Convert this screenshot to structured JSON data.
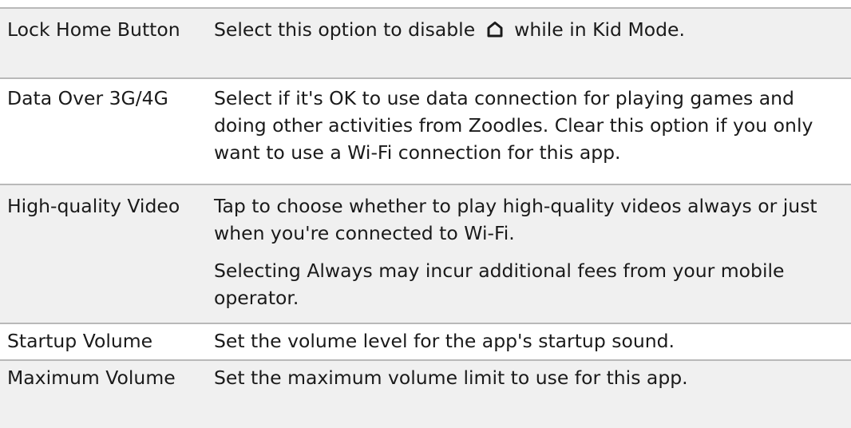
{
  "rows": [
    {
      "name": "Lock Home Button",
      "desc_before_icon": "Select this option to disable",
      "icon": "home-icon",
      "desc_after_icon": "while in Kid Mode."
    },
    {
      "name": "Data Over 3G/4G",
      "desc": "Select if it's OK to use data connection for playing games and doing other activities from Zoodles. Clear this option if you only want to use a Wi-Fi connection for this app."
    },
    {
      "name": "High-quality Video",
      "desc": "Tap to choose whether to play high-quality videos always or just when you're connected to Wi-Fi.",
      "desc2_before": "Selecting",
      "desc2_emphasis": "Always",
      "desc2_after": "may incur additional fees from your mobile operator."
    },
    {
      "name": "Startup Volume",
      "desc": "Set the volume level for the app's startup sound."
    },
    {
      "name": "Maximum Volume",
      "desc": "Set the maximum volume limit to use for this app."
    }
  ],
  "colors": {
    "row_shade": "#f0f0f0",
    "divider": "#b9b9b9",
    "text": "#1a1a1a"
  }
}
